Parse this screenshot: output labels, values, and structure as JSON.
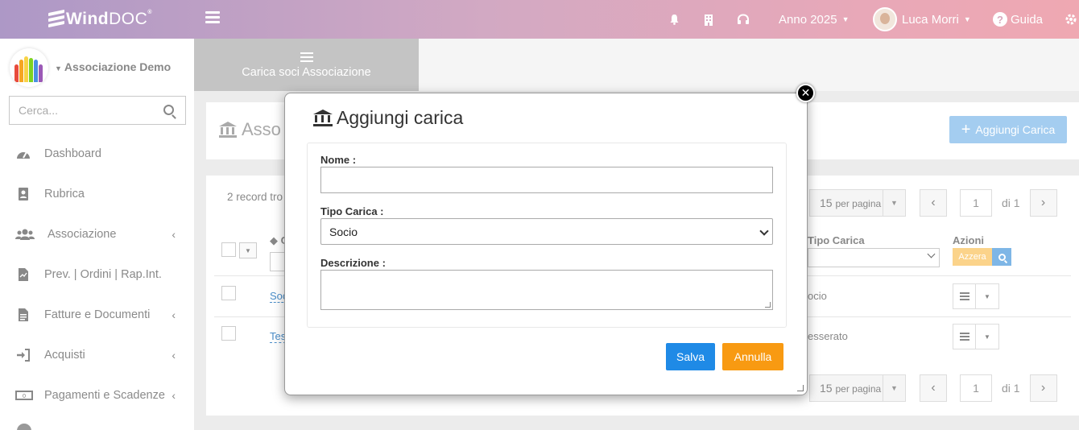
{
  "topbar": {
    "logo_wind": "Wind",
    "logo_doc": "DOC",
    "logo_reg": "®",
    "year_label": "Anno 2025",
    "user_name": "Luca Morri",
    "help_label": "Guida",
    "colors": {
      "gradient_start": "#ad98c6",
      "gradient_end": "#efa8b2"
    },
    "icons": [
      "menu-icon",
      "bell-icon",
      "building-icon",
      "headset-icon",
      "help-icon",
      "gear-icon"
    ]
  },
  "sidebar": {
    "org_name": "Associazione Demo",
    "search_placeholder": "Cerca...",
    "items": [
      {
        "label": "Dashboard",
        "icon": "dashboard-icon",
        "has_chevron": false
      },
      {
        "label": "Rubrica",
        "icon": "address-book-icon",
        "has_chevron": false
      },
      {
        "label": "Associazione",
        "icon": "users-icon",
        "has_chevron": true
      },
      {
        "label": "Prev. | Ordini | Rap.Int.",
        "icon": "document-icon",
        "has_chevron": false
      },
      {
        "label": "Fatture e Documenti",
        "icon": "file-icon",
        "has_chevron": true
      },
      {
        "label": "Acquisti",
        "icon": "sign-in-icon",
        "has_chevron": true
      },
      {
        "label": "Pagamenti e Scadenze",
        "icon": "money-icon",
        "has_chevron": true
      }
    ]
  },
  "main": {
    "tab_label": "Carica soci Associazione",
    "page_title": "Asso",
    "add_button": "Aggiungi Carica",
    "records_text": "2 record tro",
    "per_page": "15",
    "per_page_suffix": "per pagina",
    "page_current": "1",
    "page_of": "di 1",
    "columns": {
      "tipo_carica": "Tipo Carica",
      "azioni": "Azioni",
      "sort_prefix": "◆ C"
    },
    "azzera_label": "Azzera",
    "rows": [
      {
        "name": "Soc",
        "tipo": "ocio"
      },
      {
        "name": "Tes",
        "tipo": "esserato"
      }
    ]
  },
  "modal": {
    "title": "Aggiungi carica",
    "nome_label": "Nome :",
    "nome_value": "",
    "tipo_label": "Tipo Carica :",
    "tipo_value": "Socio",
    "descrizione_label": "Descrizione :",
    "save_label": "Salva",
    "cancel_label": "Annulla",
    "close_symbol": "✕",
    "colors": {
      "save": "#1f8ae6",
      "cancel": "#f89a12"
    }
  }
}
